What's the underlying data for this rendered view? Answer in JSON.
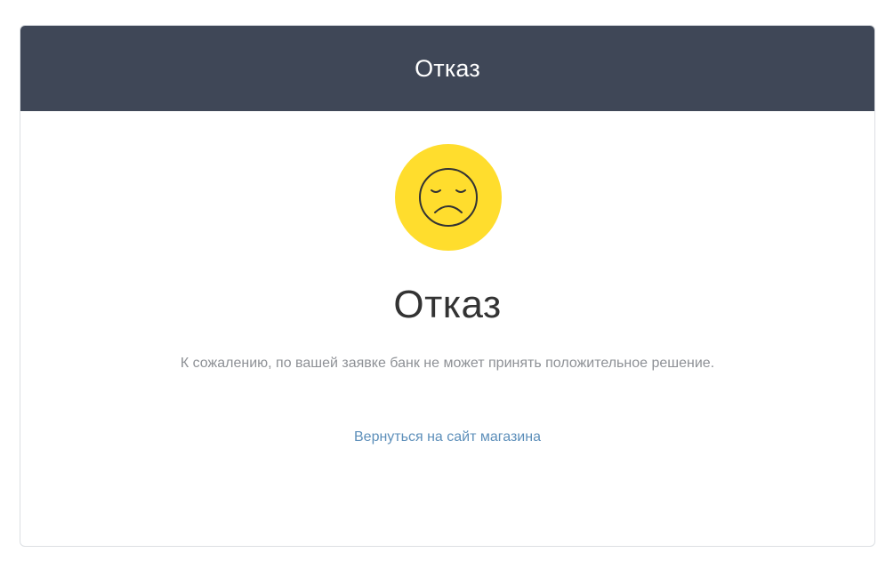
{
  "header": {
    "title": "Отказ"
  },
  "status": {
    "icon": "sad-face-icon",
    "icon_color": "#ffdd2d",
    "title": "Отказ",
    "message": "К сожалению, по вашей заявке банк не может принять положительное решение."
  },
  "actions": {
    "return_label": "Вернуться на сайт магазина"
  },
  "colors": {
    "header_bg": "#3f4757",
    "link": "#5d8fba",
    "muted_text": "#8e9196"
  }
}
